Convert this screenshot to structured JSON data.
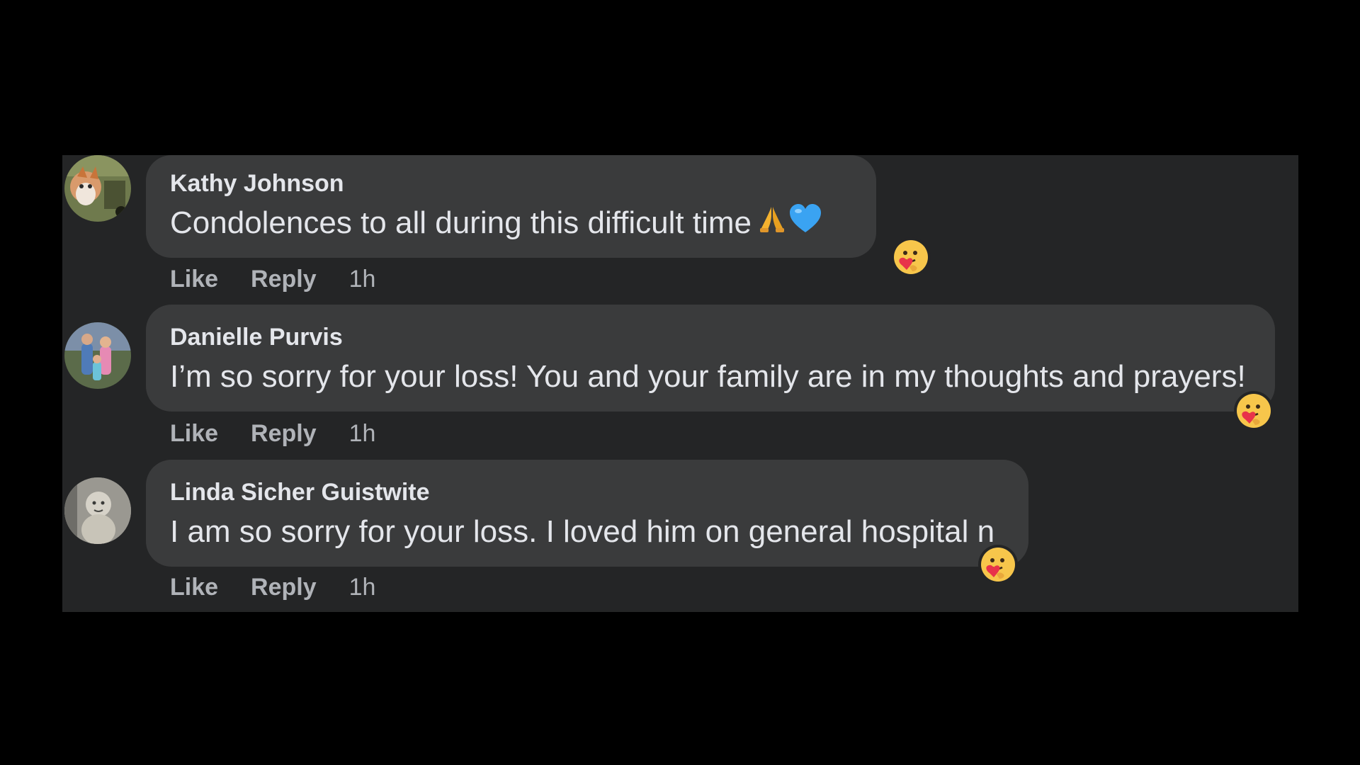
{
  "comments": [
    {
      "author": "Kathy Johnson",
      "text": "Condolences to all during this difficult time",
      "inline_emojis": [
        "folded-hands-icon",
        "blue-heart-icon"
      ],
      "reaction": "care-reaction-icon",
      "actions": {
        "like": "Like",
        "reply": "Reply",
        "time": "1h"
      }
    },
    {
      "author": "Danielle Purvis",
      "text": "I’m so sorry for your loss! You and your family are in my thoughts and prayers!",
      "reaction": "care-reaction-icon",
      "actions": {
        "like": "Like",
        "reply": "Reply",
        "time": "1h"
      }
    },
    {
      "author": "Linda Sicher Guistwite",
      "text": "I am so sorry for your loss. I loved him on general hospital n",
      "reaction": "care-reaction-icon",
      "actions": {
        "like": "Like",
        "reply": "Reply",
        "time": "1h"
      }
    }
  ],
  "colors": {
    "background": "#000000",
    "panel": "#242526",
    "bubble": "#3a3b3c",
    "primary_text": "#e4e6eb",
    "secondary_text": "#b0b3b8"
  }
}
